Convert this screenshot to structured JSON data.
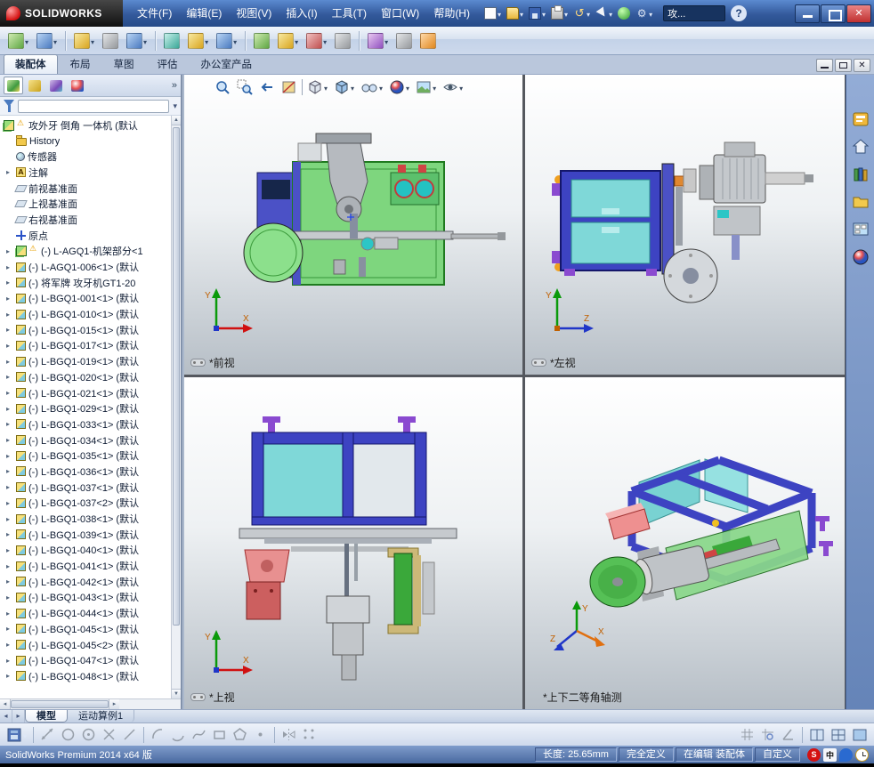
{
  "icons": {
    "dropdown": "▾",
    "expand": "▸",
    "overflow": "»",
    "close": "✕",
    "scroll_left": "◂",
    "scroll_right": "▸",
    "scroll_up": "▲",
    "scroll_down": "▼",
    "warning": "⚠"
  },
  "titlebar": {
    "brand": "SOLIDWORKS",
    "menus": [
      "文件(F)",
      "编辑(E)",
      "视图(V)",
      "插入(I)",
      "工具(T)",
      "窗口(W)",
      "帮助(H)"
    ],
    "search_value": "攻...",
    "help_label": "?"
  },
  "ribbon_tabs": [
    "装配体",
    "布局",
    "草图",
    "评估",
    "办公室产品"
  ],
  "feature_tree": {
    "root_label": "攻外牙 倒角 一体机 (默认",
    "items": [
      "History",
      "传感器",
      "注解",
      "前视基准面",
      "上视基准面",
      "右视基准面",
      "原点",
      "(-) L-AGQ1-机架部分<1",
      "(-) L-AGQ1-006<1> (默认",
      "(-) 将军牌 攻牙机GT1-20",
      "(-) L-BGQ1-001<1> (默认",
      "(-) L-BGQ1-010<1> (默认",
      "(-) L-BGQ1-015<1> (默认",
      "(-) L-BGQ1-017<1> (默认",
      "(-) L-BGQ1-019<1> (默认",
      "(-) L-BGQ1-020<1> (默认",
      "(-) L-BGQ1-021<1> (默认",
      "(-) L-BGQ1-029<1> (默认",
      "(-) L-BGQ1-033<1> (默认",
      "(-) L-BGQ1-034<1> (默认",
      "(-) L-BGQ1-035<1> (默认",
      "(-) L-BGQ1-036<1> (默认",
      "(-) L-BGQ1-037<1> (默认",
      "(-) L-BGQ1-037<2> (默认",
      "(-) L-BGQ1-038<1> (默认",
      "(-) L-BGQ1-039<1> (默认",
      "(-) L-BGQ1-040<1> (默认",
      "(-) L-BGQ1-041<1> (默认",
      "(-) L-BGQ1-042<1> (默认",
      "(-) L-BGQ1-043<1> (默认",
      "(-) L-BGQ1-044<1> (默认",
      "(-) L-BGQ1-045<1> (默认",
      "(-) L-BGQ1-045<2> (默认",
      "(-) L-BGQ1-047<1> (默认",
      "(-) L-BGQ1-048<1> (默认"
    ]
  },
  "model_tabs": [
    "模型",
    "运动算例1"
  ],
  "viewports": {
    "top_left": {
      "label": "*前视",
      "triad": {
        "v": "Y",
        "h": "X"
      }
    },
    "top_right": {
      "label": "*左视",
      "triad": {
        "v": "Y",
        "h": "Z"
      }
    },
    "bottom_left": {
      "label": "*上视",
      "triad": {
        "v": "Y",
        "h": "X"
      }
    },
    "bottom_right": {
      "label": "*上下二等角轴测",
      "triad": {
        "v": "Y",
        "l": "Z",
        "r": "X"
      }
    }
  },
  "statusbar": {
    "product": "SolidWorks Premium 2014 x64 版",
    "length": "长度: 25.65mm",
    "defined": "完全定义",
    "editing": "在编辑 装配体",
    "custom": "自定义",
    "ime": "中"
  }
}
